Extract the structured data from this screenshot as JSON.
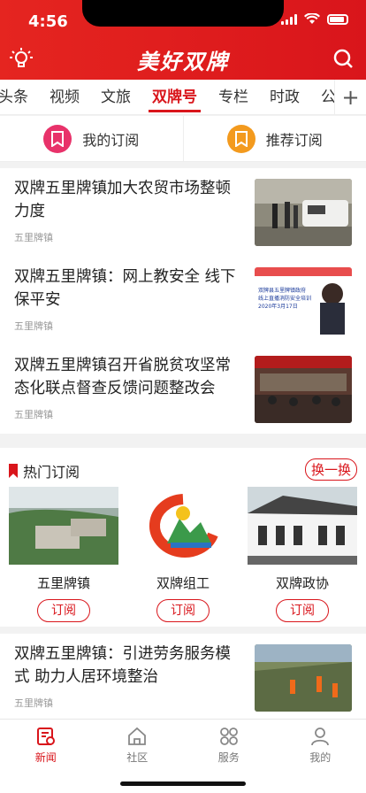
{
  "status": {
    "time": "4:56"
  },
  "header": {
    "logo_text": "美好双牌",
    "bulb_icon": "lightbulb-icon",
    "search_icon": "search-icon"
  },
  "tabs": [
    {
      "label": "头条"
    },
    {
      "label": "视频"
    },
    {
      "label": "文旅"
    },
    {
      "label": "双牌号"
    },
    {
      "label": "专栏"
    },
    {
      "label": "时政"
    },
    {
      "label": "公"
    }
  ],
  "active_tab": "双牌号",
  "plus_label": "+",
  "subscriptions": {
    "mine": "我的订阅",
    "recommended": "推荐订阅"
  },
  "articles": [
    {
      "title": "双牌五里牌镇加大农贸市场整顿力度",
      "source": "五里牌镇"
    },
    {
      "title": "双牌五里牌镇：网上教安全 线下保平安",
      "source": "五里牌镇"
    },
    {
      "title": "双牌五里牌镇召开省脱贫攻坚常态化联点督查反馈问题整改会",
      "source": "五里牌镇"
    },
    {
      "title": "双牌五里牌镇：引进劳务服务模式 助力人居环境整治",
      "source": "五里牌镇"
    }
  ],
  "thumb2": {
    "line1": "双牌县五里牌镇政府",
    "line2": "线上直播消防安全培训",
    "line3": "2020年3月17日"
  },
  "hot": {
    "title": "热门订阅",
    "swap_label": "换一换",
    "items": [
      {
        "name": "五里牌镇",
        "button": "订阅"
      },
      {
        "name": "双牌组工",
        "button": "订阅"
      },
      {
        "name": "双牌政协",
        "button": "订阅"
      }
    ]
  },
  "nav": [
    {
      "label": "新闻",
      "icon": "news-icon"
    },
    {
      "label": "社区",
      "icon": "home-icon"
    },
    {
      "label": "服务",
      "icon": "grid-icon"
    },
    {
      "label": "我的",
      "icon": "user-icon"
    }
  ],
  "colors": {
    "brand": "#d9151b",
    "accent_pink": "#e8326a",
    "accent_orange": "#f39a1e"
  }
}
